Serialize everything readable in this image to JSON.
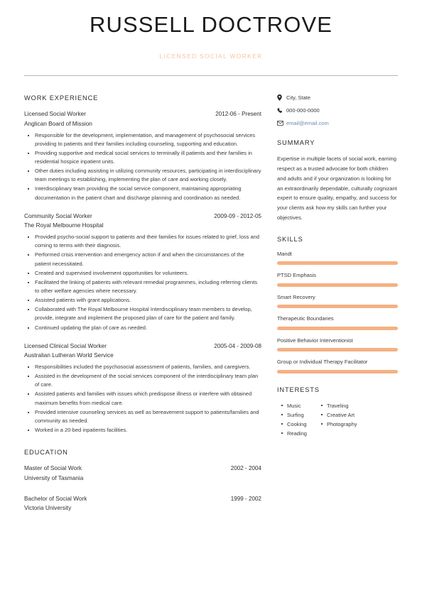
{
  "header": {
    "name": "RUSSELL DOCTROVE",
    "subtitle": "LICENSED SOCIAL WORKER"
  },
  "colors": {
    "accent_bar": "#f5b183",
    "subtitle": "#f8c4a0",
    "link": "#6f8bb0",
    "rule": "#b5b5b5"
  },
  "main": {
    "work_experience": {
      "heading": "WORK EXPERIENCE",
      "entries": [
        {
          "title": "Licensed Social Worker",
          "date": "2012-06 - Present",
          "organization": "Anglican Board of Mission",
          "bullets": [
            "Responsible for the development, implementation, and management of psychosocial services providing to patients and their families including counseling, supporting and education.",
            "Providing supportive and medical social services to terminally ill patients and their families in residential hospice inpatient units.",
            "Other duties including assisting in utilizing community resources, participating in interdisciplinary team meetings to establishing, implementing the plan of care and working closely.",
            "Interdisciplinary team providing the social service component, maintaining appropriating documentation in the patient chart and discharge planning and coordination as needed."
          ]
        },
        {
          "title": "Community Social Worker",
          "date": "2009-09 - 2012-05",
          "organization": "The Royal Melbourne Hospital",
          "bullets": [
            "Provided psycho-social support to patients and their families for issues related to grief, loss and coming to terms with their diagnosis.",
            "Performed crisis intervention and emergency action if and when the circumstances of the patient necessitated.",
            "Created and supervised involvement opportunities for volunteers.",
            "Facilitated the linking of patients with relevant remedial programmes, including referring clients to other welfare agencies where necessary.",
            "Assisted patients with grant applications.",
            "Collaborated with The Royal Melbourne Hospital Interdisciplinary team members to develop, provide, integrate and implement the proposed plan of care for the patient and family.",
            "Continued updating the plan of care as needed."
          ]
        },
        {
          "title": "Licensed Clinical Social Worker",
          "date": "2005-04 - 2009-08",
          "organization": "Australian Lutheran World Service",
          "bullets": [
            "Responsibilities included the psychosocial assessment of patients, families, and caregivers.",
            "Assisted in the development of the social services component of the interdisciplinary team plan of care.",
            "Assisted patients and families with issues which predispose illness or interfere with obtained maximum benefits from medical care.",
            "Provided intensive counseling services as well as bereavement support to patients/families and community as needed.",
            "Worked in a 20-bed inpatients facilities."
          ]
        }
      ]
    },
    "education": {
      "heading": "EDUCATION",
      "entries": [
        {
          "degree": "Master of Social Work",
          "date": "2002 - 2004",
          "school": "University of Tasmania"
        },
        {
          "degree": "Bachelor of Social Work",
          "date": "1999 - 2002",
          "school": "Victoria University"
        }
      ]
    }
  },
  "sidebar": {
    "contact": [
      {
        "icon": "location-pin-icon",
        "value": "City, State"
      },
      {
        "icon": "phone-icon",
        "value": "000-000-0000"
      },
      {
        "icon": "envelope-icon",
        "value": "email@email.com"
      }
    ],
    "summary": {
      "heading": "SUMMARY",
      "text": "Expertise in multiple facets of social work, earning respect as a trusted advocate for both children and adults and if your organization is looking for an extraordinarily dependable, culturally cognizant expert to ensure quality, empathy, and success for your clients ask how my skills can further your objectives."
    },
    "skills": {
      "heading": "SKILLS",
      "items": [
        {
          "name": "Mandt",
          "level": 100
        },
        {
          "name": "PTSD Emphasis",
          "level": 100
        },
        {
          "name": "Smart Recovery",
          "level": 100
        },
        {
          "name": "Therapeutic Boundaries",
          "level": 100
        },
        {
          "name": "Positive Behavior Interventionist",
          "level": 100
        },
        {
          "name": "Group or Individual Therapy Facilitator",
          "level": 100
        }
      ]
    },
    "interests": {
      "heading": "INTERESTS",
      "column_left": [
        "Music",
        "Surfing",
        "Cooking",
        "Reading"
      ],
      "column_right": [
        "Traveling",
        "Creative Art",
        "Photography"
      ]
    }
  }
}
